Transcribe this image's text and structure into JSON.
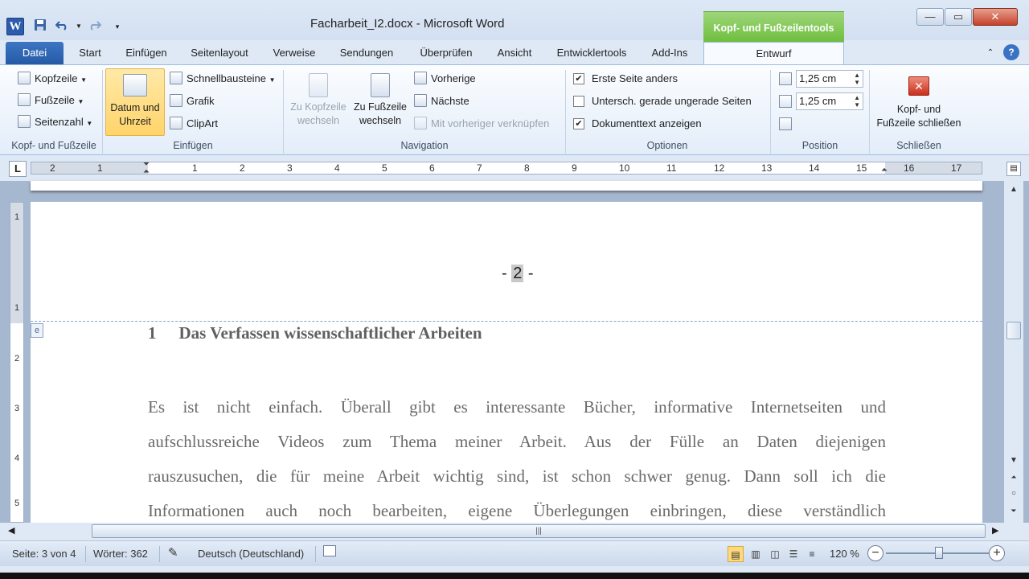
{
  "window": {
    "title": "Facharbeit_I2.docx - Microsoft Word",
    "word_icon": "W",
    "contextual_header": "Kopf- und Fußzeilentools",
    "controls": {
      "minimize": "—",
      "maximize": "▭",
      "close": "✕"
    }
  },
  "qat": {
    "save_icon": "save-icon",
    "undo_icon": "undo-icon",
    "redo_icon": "redo-icon"
  },
  "tabs": {
    "datei": "Datei",
    "start": "Start",
    "einfuegen": "Einfügen",
    "seitenlayout": "Seitenlayout",
    "verweise": "Verweise",
    "sendungen": "Sendungen",
    "ueberpruefen": "Überprüfen",
    "ansicht": "Ansicht",
    "entwicklertools": "Entwicklertools",
    "addins": "Add-Ins",
    "entwurf": "Entwurf"
  },
  "ribbon": {
    "group_kopf": {
      "label": "Kopf- und Fußzeile",
      "kopfzeile": "Kopfzeile",
      "fusszeile": "Fußzeile",
      "seitenzahl": "Seitenzahl"
    },
    "group_einfuegen": {
      "label": "Einfügen",
      "datum_line1": "Datum und",
      "datum_line2": "Uhrzeit",
      "schnellbausteine": "Schnellbausteine",
      "grafik": "Grafik",
      "clipart": "ClipArt"
    },
    "group_navigation": {
      "label": "Navigation",
      "zu_kopf_line1": "Zu Kopfzeile",
      "zu_kopf_line2": "wechseln",
      "zu_fuss_line1": "Zu Fußzeile",
      "zu_fuss_line2": "wechseln",
      "vorherige": "Vorherige",
      "naechste": "Nächste",
      "verknuepfen": "Mit vorheriger verknüpfen"
    },
    "group_optionen": {
      "label": "Optionen",
      "erste_seite": "Erste Seite anders",
      "erste_seite_checked": true,
      "untersch": "Untersch. gerade  ungerade Seiten",
      "untersch_checked": false,
      "dokumenttext": "Dokumenttext anzeigen",
      "dokumenttext_checked": true
    },
    "group_position": {
      "label": "Position",
      "header_pos": "1,25 cm",
      "footer_pos": "1,25 cm"
    },
    "group_schliessen": {
      "label": "Schließen",
      "close_line1": "Kopf- und",
      "close_line2": "Fußzeile schließen"
    }
  },
  "ruler": {
    "tab_selector": "L",
    "left_numbers": [
      "2",
      "1"
    ],
    "right_numbers": [
      "1",
      "2",
      "3",
      "4",
      "5",
      "6",
      "7",
      "8",
      "9",
      "10",
      "11",
      "12",
      "13",
      "14",
      "15",
      "16",
      "17"
    ],
    "vertical_numbers": [
      "1",
      "1",
      "2",
      "3",
      "4",
      "5"
    ]
  },
  "document": {
    "page_number_prefix": "- ",
    "page_number": "2",
    "page_number_suffix": " -",
    "header_tag": "e",
    "heading_number": "1",
    "heading_text": "Das Verfassen wissenschaftlicher Arbeiten",
    "paragraph_lines": [
      "Es ist nicht einfach. Überall gibt es interessante Bücher, informative Internetseiten und",
      "aufschlussreiche Videos zum Thema meiner Arbeit. Aus der Fülle an Daten diejenigen",
      "rauszusuchen, die für meine Arbeit wichtig sind, ist schon schwer genug. Dann soll ich die",
      "Informationen auch noch bearbeiten, eigene Überlegungen einbringen, diese verständlich"
    ]
  },
  "status": {
    "page": "Seite: 3 von 4",
    "words": "Wörter: 362",
    "language": "Deutsch (Deutschland)",
    "zoom": "120 %",
    "zoom_level": 120
  }
}
